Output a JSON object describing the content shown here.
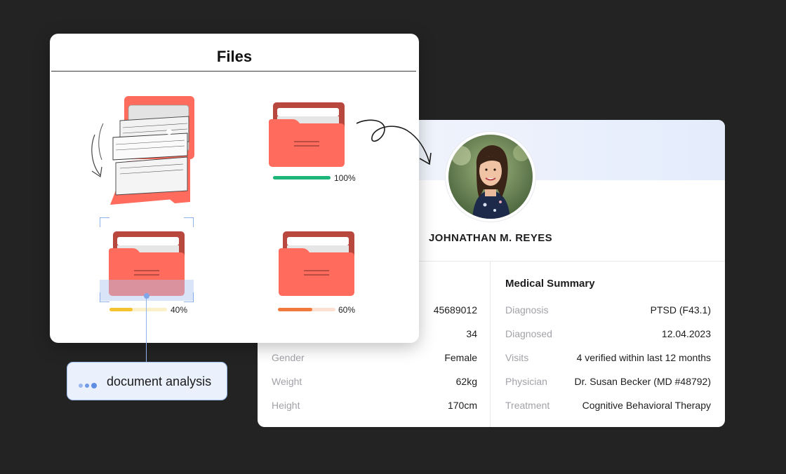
{
  "files_panel": {
    "title": "Files",
    "items": [
      {
        "state": "opening",
        "icon": "open-folder-icon"
      },
      {
        "state": "complete",
        "progress_percent": 100,
        "progress_label": "100%",
        "bar_color": "#1db57a",
        "track_color": "#cdeedd",
        "icon": "folder-icon"
      },
      {
        "state": "selected",
        "progress_percent": 40,
        "progress_label": "40%",
        "bar_color": "#f5c230",
        "track_color": "#fbefc8",
        "icon": "folder-icon"
      },
      {
        "state": "in-progress",
        "progress_percent": 60,
        "progress_label": "60%",
        "bar_color": "#f07a3c",
        "track_color": "#fde0d2",
        "icon": "folder-icon"
      }
    ]
  },
  "analysis_tag": {
    "label": "document analysis",
    "icon": "dots-icon"
  },
  "patient": {
    "name": "JOHNATHAN M. REYES",
    "avatar": "avatar-photo",
    "details": [
      {
        "key": "",
        "value": "45689012"
      },
      {
        "key": "",
        "value": "34"
      },
      {
        "key": "Gender",
        "value": "Female"
      },
      {
        "key": "Weight",
        "value": "62kg"
      },
      {
        "key": "Height",
        "value": "170cm"
      }
    ],
    "medical_summary": {
      "title": "Medical Summary",
      "rows": [
        {
          "key": "Diagnosis",
          "value": "PTSD (F43.1)"
        },
        {
          "key": "Diagnosed",
          "value": "12.04.2023"
        },
        {
          "key": "Visits",
          "value": "4 verified within last 12 months"
        },
        {
          "key": "Physician",
          "value": "Dr. Susan Becker (MD #48792)"
        },
        {
          "key": "Treatment",
          "value": "Cognitive Behavioral Therapy"
        }
      ]
    }
  },
  "colors": {
    "background": "#232323",
    "folder": "#ff6b5c",
    "folder_back": "#b8473e",
    "accent_blue": "#7fa6e8"
  }
}
